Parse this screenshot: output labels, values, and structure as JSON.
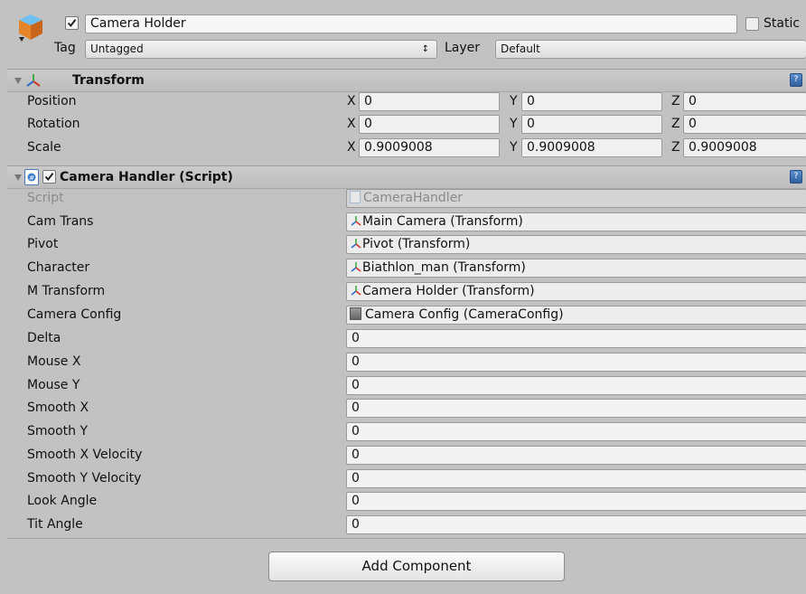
{
  "gameobject": {
    "name": "Camera Holder",
    "active": true,
    "static_label": "Static",
    "tag_label": "Tag",
    "tag_value": "Untagged",
    "layer_label": "Layer",
    "layer_value": "Default"
  },
  "transform": {
    "title": "Transform",
    "rows": [
      {
        "label": "Position",
        "x": "0",
        "y": "0",
        "z": "0"
      },
      {
        "label": "Rotation",
        "x": "0",
        "y": "0",
        "z": "0"
      },
      {
        "label": "Scale",
        "x": "0.9009008",
        "y": "0.9009008",
        "z": "0.9009008"
      }
    ],
    "axis_x": "X",
    "axis_y": "Y",
    "axis_z": "Z"
  },
  "camera_handler": {
    "title": "Camera Handler (Script)",
    "enabled": true,
    "script_label": "Script",
    "script_value": "CameraHandler",
    "object_fields": [
      {
        "label": "Cam Trans",
        "value": "Main Camera (Transform)",
        "icon": "transform-icon"
      },
      {
        "label": "Pivot",
        "value": "Pivot (Transform)",
        "icon": "transform-icon"
      },
      {
        "label": "Character",
        "value": "Biathlon_man (Transform)",
        "icon": "transform-icon"
      },
      {
        "label": "M Transform",
        "value": "Camera Holder (Transform)",
        "icon": "transform-icon"
      },
      {
        "label": "Camera Config",
        "value": "Camera Config (CameraConfig)",
        "icon": "scriptable-object-icon"
      }
    ],
    "number_fields": [
      {
        "label": "Delta",
        "value": "0"
      },
      {
        "label": "Mouse X",
        "value": "0"
      },
      {
        "label": "Mouse Y",
        "value": "0"
      },
      {
        "label": "Smooth X",
        "value": "0"
      },
      {
        "label": "Smooth Y",
        "value": "0"
      },
      {
        "label": "Smooth X Velocity",
        "value": "0"
      },
      {
        "label": "Smooth Y Velocity",
        "value": "0"
      },
      {
        "label": "Look Angle",
        "value": "0"
      },
      {
        "label": "Tit Angle",
        "value": "0"
      }
    ]
  },
  "add_component_label": "Add Component"
}
